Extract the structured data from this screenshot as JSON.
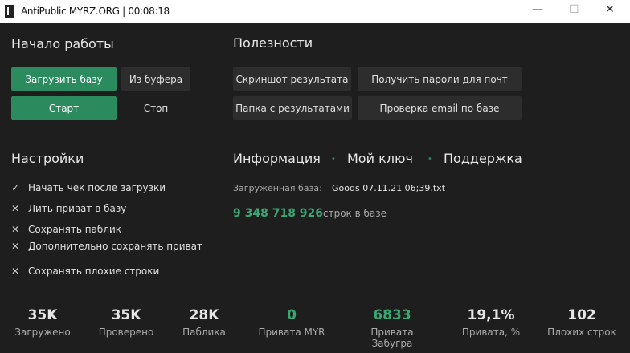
{
  "window": {
    "title": "AntiPublic MYRZ.ORG | 00:08:18",
    "minimize": "—",
    "maximize": "☐",
    "close": "✕"
  },
  "start": {
    "heading": "Начало работы",
    "load": "Загрузить базу",
    "clipboard": "Из буфера",
    "start": "Старт",
    "stop": "Стоп"
  },
  "utils": {
    "heading": "Полезности",
    "screenshot": "Скриншот результата",
    "get_passwords": "Получить пароли для почт",
    "folder": "Папка с результатами",
    "check_email": "Проверка email по базе"
  },
  "settings": {
    "heading": "Настройки",
    "items": [
      {
        "label": "Начать чек после загрузки",
        "icon": "✓"
      },
      {
        "label": "Лить приват в базу",
        "icon": "✕"
      },
      {
        "label": "Сохранять паблик",
        "icon": "✕"
      },
      {
        "label": "Дополнительно сохранять приват",
        "icon": "✕"
      },
      {
        "label": "Сохранять плохие строки",
        "icon": "✕"
      }
    ]
  },
  "info": {
    "tabs": [
      "Информация",
      "Мой ключ",
      "Поддержка"
    ],
    "loaded_label": "Загруженная база:",
    "loaded_value": "Goods 07.11.21 06;39.txt",
    "count": "9 348 718 926",
    "count_label": "строк в базе"
  },
  "stats": [
    {
      "value": "35K",
      "label": "Загружено"
    },
    {
      "value": "35K",
      "label": "Проверено"
    },
    {
      "value": "28K",
      "label": "Паблика"
    },
    {
      "value": "0",
      "label": "Привата MYR"
    },
    {
      "value": "6833",
      "label": "Привата Забугра"
    },
    {
      "value": "19,1%",
      "label": "Привата, %"
    },
    {
      "value": "102",
      "label": "Плохих строк"
    }
  ],
  "colors": {
    "accent": "#2b8a5e",
    "background": "#1e1e1e"
  }
}
